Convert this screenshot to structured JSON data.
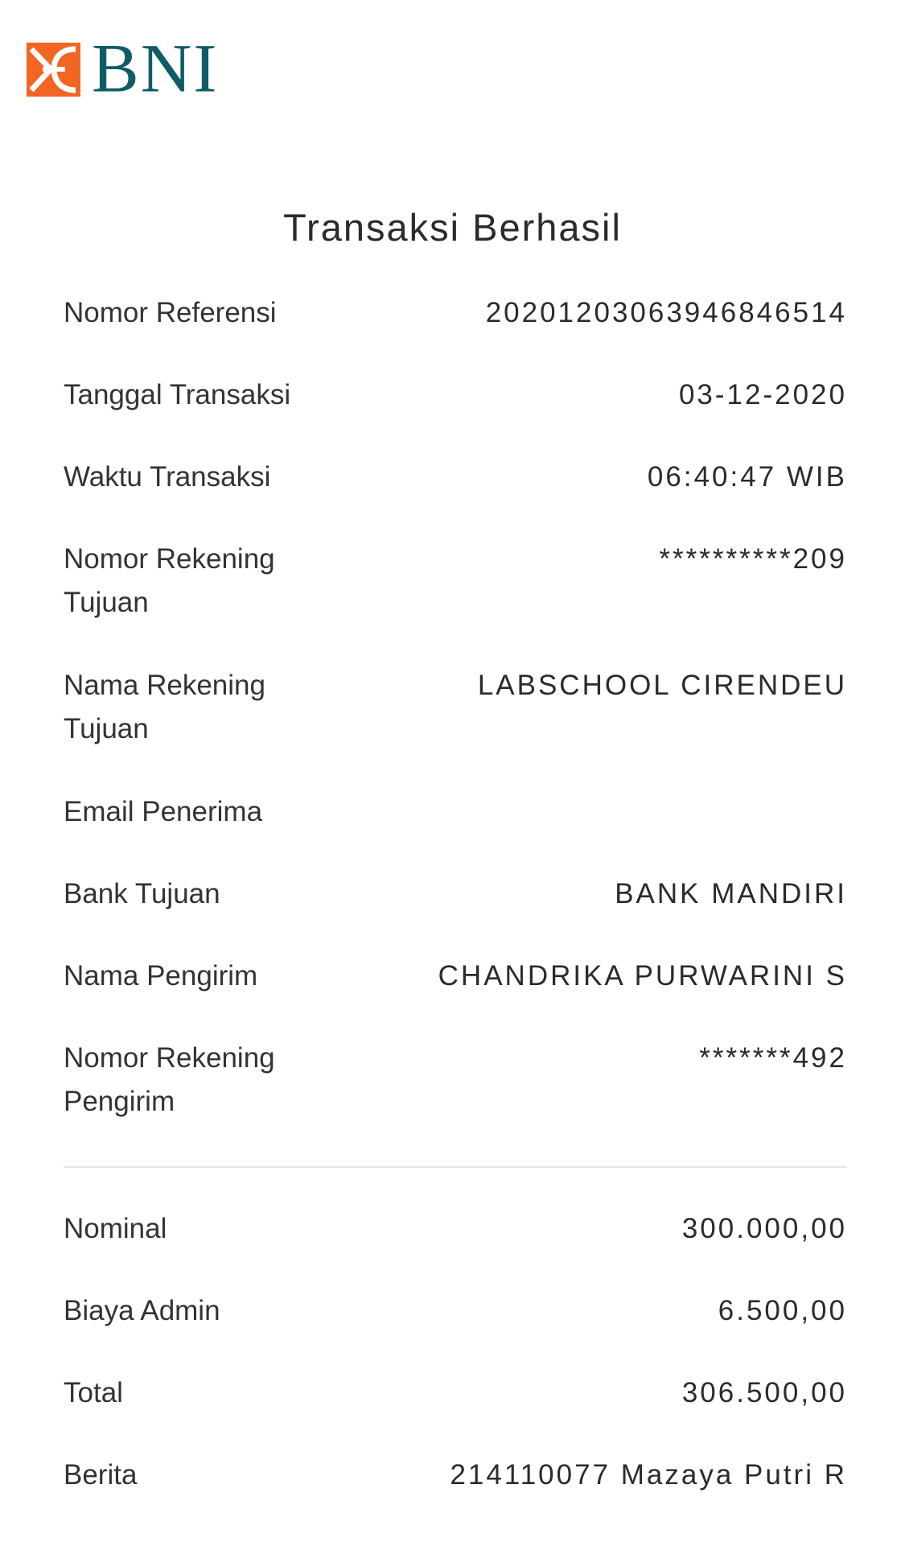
{
  "brand": {
    "name": "BNI",
    "colors": {
      "mark": "#f26622",
      "text": "#0d5c66"
    }
  },
  "title": "Transaksi Berhasil",
  "details": [
    {
      "label": "Nomor Referensi",
      "value": "20201203063946846514"
    },
    {
      "label": "Tanggal Transaksi",
      "value": "03-12-2020"
    },
    {
      "label": "Waktu Transaksi",
      "value": "06:40:47 WIB"
    },
    {
      "label": "Nomor Rekening Tujuan",
      "value": "**********209"
    },
    {
      "label": "Nama Rekening Tujuan",
      "value": "LABSCHOOL CIRENDEU"
    },
    {
      "label": "Email Penerima",
      "value": ""
    },
    {
      "label": "Bank Tujuan",
      "value": "BANK MANDIRI"
    },
    {
      "label": "Nama Pengirim",
      "value": "CHANDRIKA PURWARINI S"
    },
    {
      "label": "Nomor Rekening Pengirim",
      "value": "*******492"
    }
  ],
  "summary": [
    {
      "label": "Nominal",
      "value": "300.000,00"
    },
    {
      "label": "Biaya Admin",
      "value": "6.500,00"
    },
    {
      "label": "Total",
      "value": "306.500,00"
    },
    {
      "label": "Berita",
      "value": "214110077 Mazaya Putri R"
    }
  ]
}
